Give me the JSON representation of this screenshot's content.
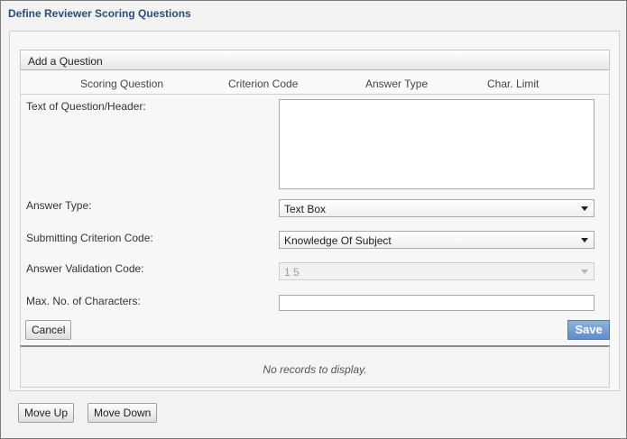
{
  "page": {
    "title": "Define Reviewer Scoring Questions"
  },
  "section": {
    "title": "Add a Question"
  },
  "columns": [
    "Scoring Question",
    "Criterion Code",
    "Answer Type",
    "Char. Limit"
  ],
  "form": {
    "question_label": "Text of Question/Header:",
    "question_value": "",
    "answer_type_label": "Answer Type:",
    "answer_type_value": "Text Box",
    "criterion_label": "Submitting Criterion Code:",
    "criterion_value": "Knowledge Of Subject",
    "validation_label": "Answer Validation Code:",
    "validation_value": "1 5",
    "max_chars_label": "Max. No. of Characters:",
    "max_chars_value": ""
  },
  "buttons": {
    "cancel": "Cancel",
    "save": "Save",
    "move_up": "Move Up",
    "move_down": "Move Down"
  },
  "records": {
    "empty_text": "No records to display."
  },
  "colors": {
    "title": "#2b4d7a",
    "save_button": "#5f8ccb"
  }
}
